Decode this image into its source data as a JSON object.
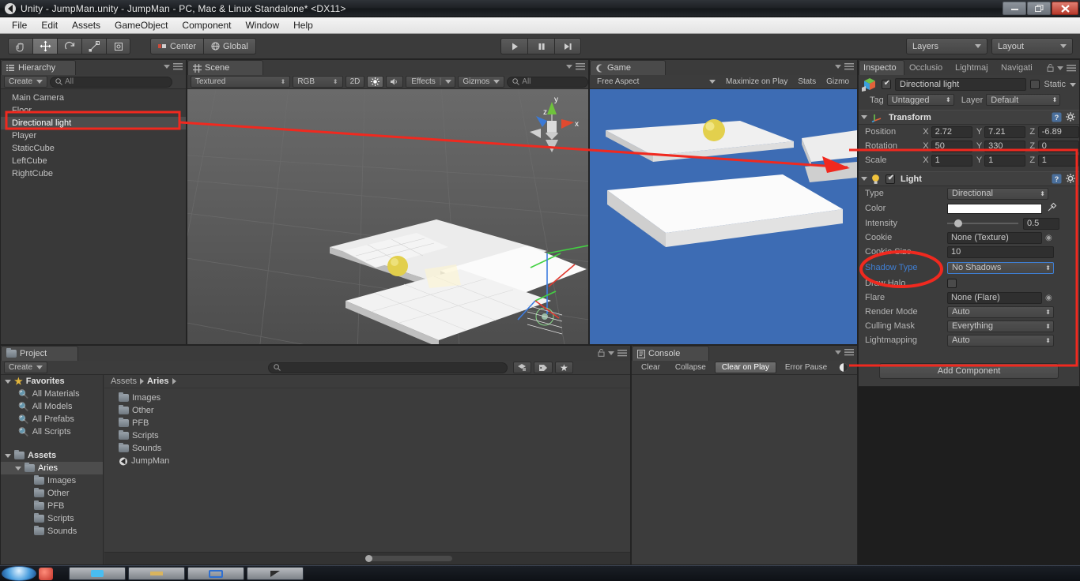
{
  "window": {
    "title": "Unity - JumpMan.unity - JumpMan - PC, Mac & Linux Standalone* <DX11>",
    "minimize_label": "—",
    "restore_label": "❐",
    "close_label": "✕"
  },
  "menubar": {
    "items": [
      "File",
      "Edit",
      "Assets",
      "GameObject",
      "Component",
      "Window",
      "Help"
    ]
  },
  "toolbar": {
    "tools": [
      {
        "name": "hand-tool",
        "glyph": "✋",
        "active": false
      },
      {
        "name": "move-tool",
        "glyph": "✥",
        "active": true
      },
      {
        "name": "rotate-tool",
        "glyph": "⟳",
        "active": false
      },
      {
        "name": "scale-tool",
        "glyph": "⤢",
        "active": false
      },
      {
        "name": "rect-tool",
        "glyph": "▣",
        "active": false
      }
    ],
    "pivot_label": "Center",
    "space_label": "Global",
    "play_label": "▶",
    "pause_label": "❚❚",
    "step_label": "▶❙",
    "layers_label": "Layers",
    "layout_label": "Layout"
  },
  "hierarchy": {
    "tab_label": "Hierarchy",
    "create_label": "Create",
    "search_placeholder": "All",
    "items": [
      {
        "label": "Main Camera",
        "selected": false
      },
      {
        "label": "Floor",
        "selected": false
      },
      {
        "label": "Directional light",
        "selected": true
      },
      {
        "label": "Player",
        "selected": false
      },
      {
        "label": "StaticCube",
        "selected": false
      },
      {
        "label": "LeftCube",
        "selected": false
      },
      {
        "label": "RightCube",
        "selected": false
      }
    ]
  },
  "scene": {
    "tab_label": "Scene",
    "draw_mode": "Textured",
    "color_mode": "RGB",
    "toggle_2d": "2D",
    "light_icon": "☀",
    "audio_icon": "🔊",
    "effects_label": "Effects",
    "gizmos_label": "Gizmos",
    "search_placeholder": "All",
    "gizmo_axes": {
      "x": "x",
      "y": "y",
      "z": "z"
    }
  },
  "game": {
    "tab_label": "Game",
    "aspect_label": "Free Aspect",
    "maximize_label": "Maximize on Play",
    "stats_label": "Stats",
    "gizmos_label": "Gizmo"
  },
  "inspector": {
    "tabs": [
      {
        "label": "Inspecto",
        "active": true
      },
      {
        "label": "Occlusio",
        "active": false
      },
      {
        "label": "Lightmaj",
        "active": false
      },
      {
        "label": "Navigati",
        "active": false
      }
    ],
    "object_name": "Directional light",
    "object_enabled": true,
    "static_label": "Static",
    "static_checked": false,
    "tag_label": "Tag",
    "tag_value": "Untagged",
    "layer_label": "Layer",
    "layer_value": "Default",
    "transform": {
      "title": "Transform",
      "rows": [
        {
          "name": "Position",
          "x": "2.72",
          "y": "7.21",
          "z": "-6.89"
        },
        {
          "name": "Rotation",
          "x": "50",
          "y": "330",
          "z": "0"
        },
        {
          "name": "Scale",
          "x": "1",
          "y": "1",
          "z": "1"
        }
      ],
      "axis_labels": [
        "X",
        "Y",
        "Z"
      ]
    },
    "light": {
      "title": "Light",
      "enabled": true,
      "type_label": "Type",
      "type_value": "Directional",
      "color_label": "Color",
      "color_value": "#ffffff",
      "intensity_label": "Intensity",
      "intensity_value": "0.5",
      "intensity_pct": 14,
      "cookie_label": "Cookie",
      "cookie_value": "None (Texture)",
      "cookie_size_label": "Cookie Size",
      "cookie_size_value": "10",
      "shadow_type_label": "Shadow Type",
      "shadow_type_value": "No Shadows",
      "shadow_type_highlight_color": "#3f7fd4",
      "draw_halo_label": "Draw Halo",
      "draw_halo_checked": false,
      "flare_label": "Flare",
      "flare_value": "None (Flare)",
      "render_mode_label": "Render Mode",
      "render_mode_value": "Auto",
      "culling_mask_label": "Culling Mask",
      "culling_mask_value": "Everything",
      "lightmapping_label": "Lightmapping",
      "lightmapping_value": "Auto"
    },
    "add_component_label": "Add Component"
  },
  "project": {
    "tab_label": "Project",
    "create_label": "Create",
    "search_placeholder": "",
    "favorites_label": "Favorites",
    "favorites": [
      "All Materials",
      "All Models",
      "All Prefabs",
      "All Scripts"
    ],
    "assets_label": "Assets",
    "tree": [
      {
        "label": "Aries",
        "depth": 1,
        "selected": true
      },
      {
        "label": "Images",
        "depth": 2,
        "selected": false
      },
      {
        "label": "Other",
        "depth": 2,
        "selected": false
      },
      {
        "label": "PFB",
        "depth": 2,
        "selected": false
      },
      {
        "label": "Scripts",
        "depth": 2,
        "selected": false
      },
      {
        "label": "Sounds",
        "depth": 2,
        "selected": false
      }
    ],
    "breadcrumb": [
      "Assets",
      "Aries"
    ],
    "contents": [
      {
        "label": "Images",
        "kind": "folder"
      },
      {
        "label": "Other",
        "kind": "folder"
      },
      {
        "label": "PFB",
        "kind": "folder"
      },
      {
        "label": "Scripts",
        "kind": "folder"
      },
      {
        "label": "Sounds",
        "kind": "folder"
      },
      {
        "label": "JumpMan",
        "kind": "scene"
      }
    ]
  },
  "console": {
    "tab_label": "Console",
    "clear_label": "Clear",
    "collapse_label": "Collapse",
    "clear_on_play_label": "Clear on Play",
    "clear_on_play_active": true,
    "error_pause_label": "Error Pause"
  },
  "annotations": {
    "accent_color": "#f0291f",
    "hierarchy_box": true,
    "inspector_box": true,
    "shadow_ellipse": true,
    "arrow": true
  }
}
